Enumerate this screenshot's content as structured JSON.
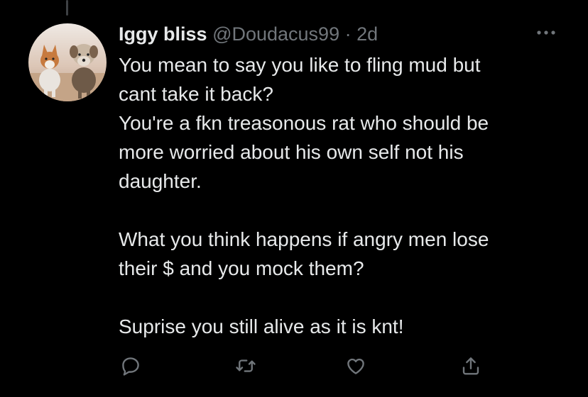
{
  "tweet": {
    "display_name": "Iggy bliss",
    "handle": "@Doudacus99",
    "separator": "·",
    "age": "2d",
    "lines": [
      "You mean to say you like to fling mud but",
      "cant take it back?",
      "You're a fkn treasonous rat who should be",
      "more worried about his own self not his",
      "daughter.",
      "",
      "What you think happens if angry men lose",
      "their $ and you mock them?",
      "",
      "Suprise you still alive as it is knt!"
    ]
  },
  "icons": {
    "more": "more-dots-icon",
    "reply": "reply-icon",
    "retweet": "retweet-icon",
    "like": "like-icon",
    "share": "share-icon"
  },
  "colors": {
    "background": "#000000",
    "text": "#e7e9ea",
    "secondary": "#71767b"
  }
}
